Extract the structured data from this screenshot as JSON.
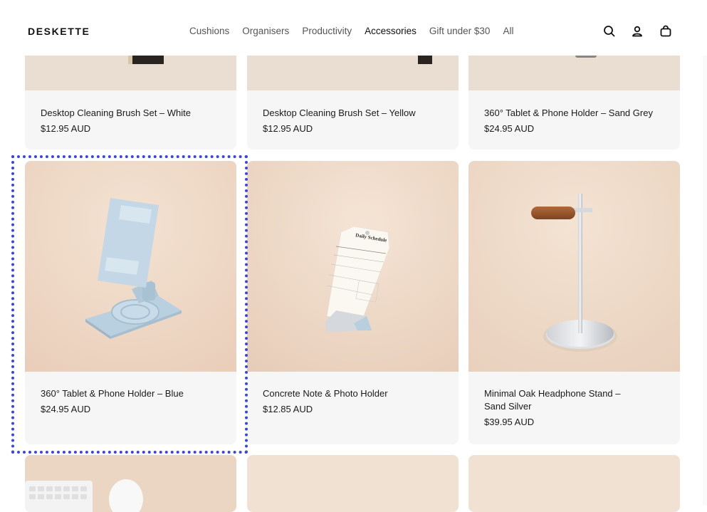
{
  "header": {
    "logo": "DESKETTE",
    "nav": [
      "Cushions",
      "Organisers",
      "Productivity",
      "Accessories",
      "Gift under $30",
      "All"
    ],
    "active_nav": "Accessories",
    "icons": [
      "search-icon",
      "account-icon",
      "cart-icon"
    ]
  },
  "products": [
    {
      "title": "Desktop Cleaning Brush Set – White",
      "price": "$12.95 AUD"
    },
    {
      "title": "Desktop Cleaning Brush Set – Yellow",
      "price": "$12.95 AUD"
    },
    {
      "title": "360° Tablet & Phone Holder – Sand Grey",
      "price": "$24.95 AUD"
    },
    {
      "title": "360° Tablet & Phone Holder – Blue",
      "price": "$24.95 AUD"
    },
    {
      "title": "Concrete Note & Photo Holder",
      "price": "$12.85 AUD"
    },
    {
      "title_line1": "Minimal Oak Headphone Stand –",
      "title_line2": "Sand Silver",
      "price": "$39.95 AUD"
    }
  ],
  "note_card": {
    "heading": "Daily Schedule"
  },
  "colors": {
    "highlight": "#3b45e0",
    "card_bg": "#f6f6f6",
    "image_bg": "#ecdccd"
  }
}
